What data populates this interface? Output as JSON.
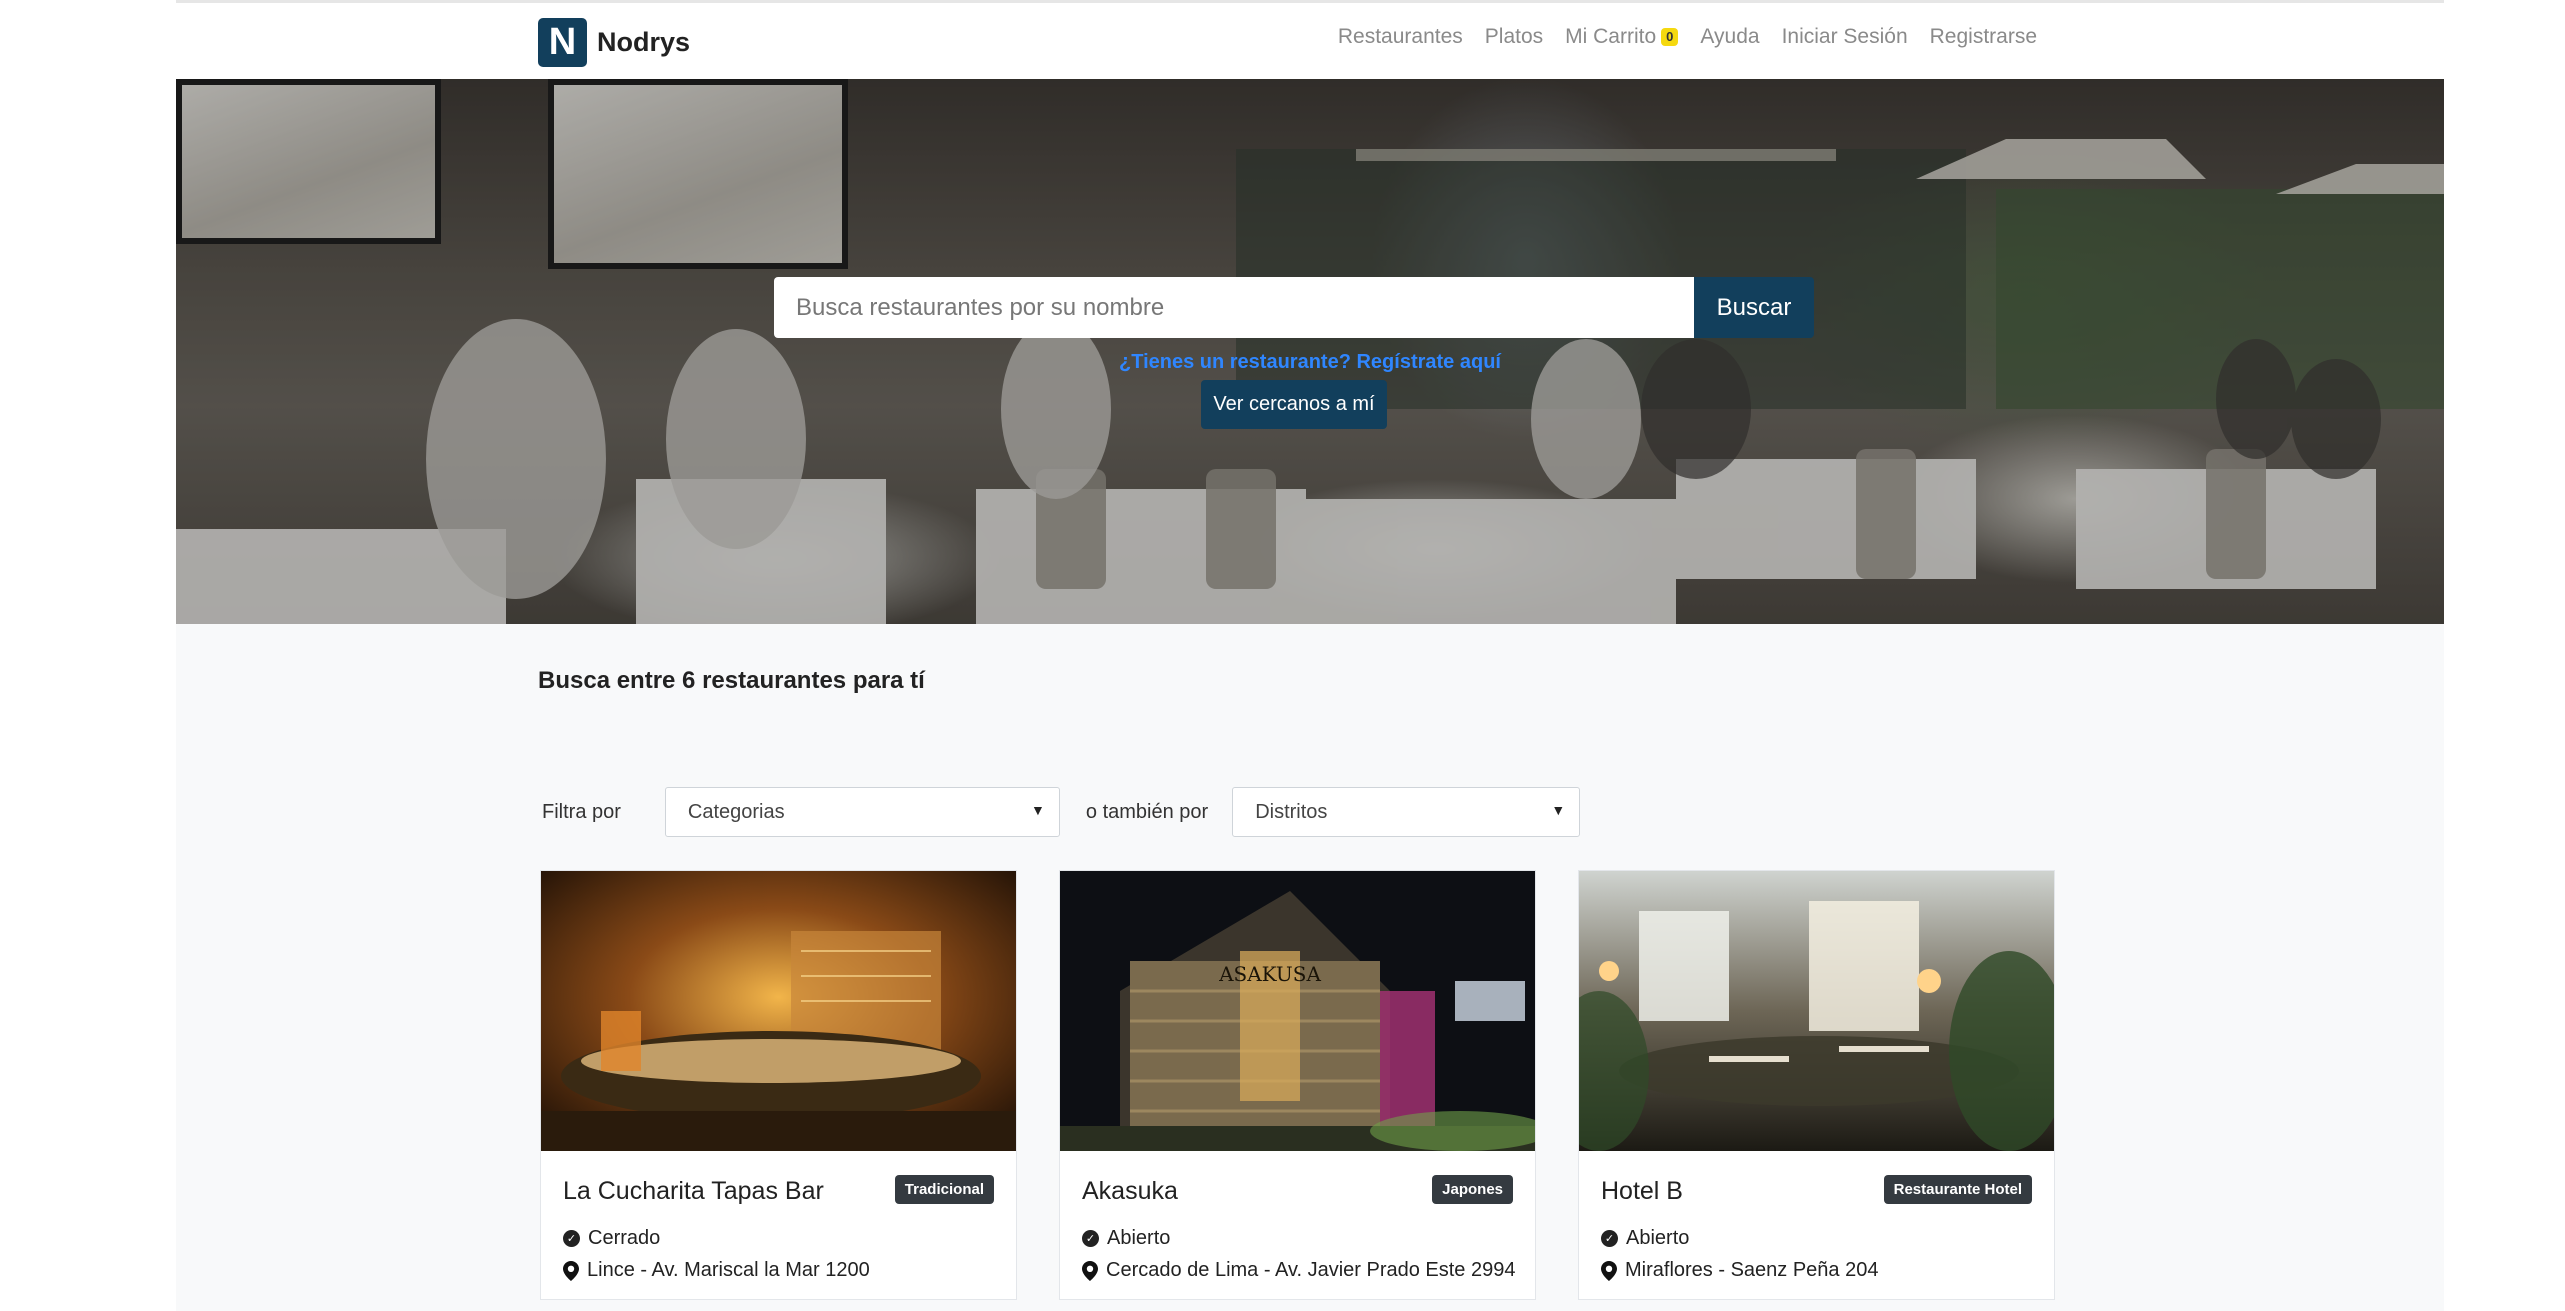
{
  "navbar": {
    "brand_letter": "N",
    "brand_name": "Nodrys",
    "links": [
      {
        "label": "Restaurantes"
      },
      {
        "label": "Platos"
      },
      {
        "label": "Mi Carrito",
        "badge": "0"
      },
      {
        "label": "Ayuda"
      },
      {
        "label": "Iniciar Sesión"
      },
      {
        "label": "Registrarse"
      }
    ]
  },
  "hero": {
    "search_placeholder": "Busca restaurantes por su nombre",
    "search_button": "Buscar",
    "register_link": "¿Tienes un restaurante? Regístrate aquí",
    "near_button": "Ver cercanos a mí"
  },
  "main": {
    "title": "Busca entre 6 restaurantes para tí",
    "filters": {
      "label_1": "Filtra por",
      "select_1": "Categorias",
      "label_2": "o también por",
      "select_2": "Distritos"
    },
    "cards": [
      {
        "name": "La Cucharita Tapas Bar",
        "badge": "Tradicional",
        "status": "Cerrado",
        "address": "Lince - Av. Mariscal la Mar 1200"
      },
      {
        "name": "Akasuka",
        "badge": "Japones",
        "status": "Abierto",
        "address": "Cercado de Lima - Av. Javier Prado Este 2994",
        "sign_text": "ASAKUSA"
      },
      {
        "name": "Hotel B",
        "badge": "Restaurante Hotel",
        "status": "Abierto",
        "address": "Miraflores - Saenz Peña 204"
      }
    ]
  }
}
